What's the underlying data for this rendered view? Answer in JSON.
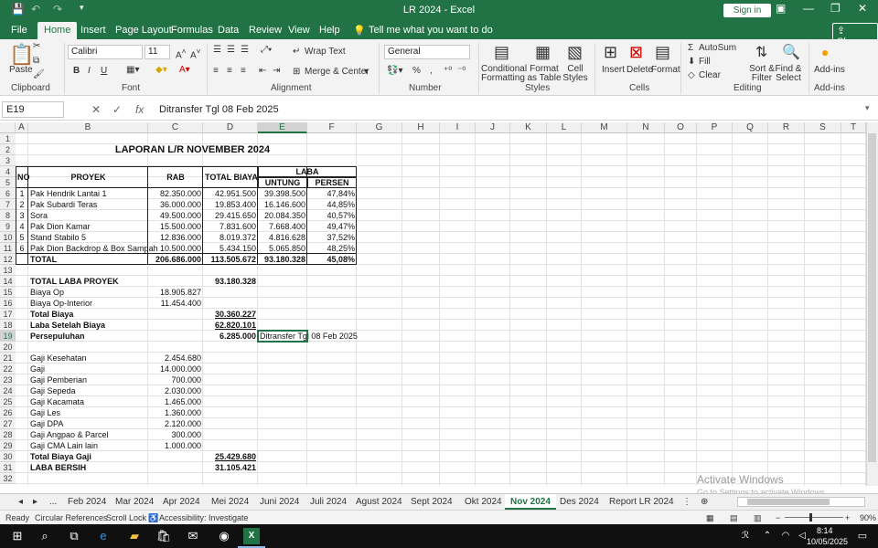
{
  "window": {
    "title": "LR 2024  -  Excel",
    "signin": "Sign in"
  },
  "menu": {
    "tabs": [
      "File",
      "Home",
      "Insert",
      "Page Layout",
      "Formulas",
      "Data",
      "Review",
      "View",
      "Help"
    ],
    "tell": "Tell me what you want to do",
    "share": "Share"
  },
  "ribbon": {
    "clipboard": {
      "paste": "Paste",
      "label": "Clipboard"
    },
    "font": {
      "name": "Calibri",
      "size": "11",
      "label": "Font",
      "bold": "B",
      "italic": "I",
      "underline": "U"
    },
    "alignment": {
      "wrap": "Wrap Text",
      "merge": "Merge & Center",
      "label": "Alignment"
    },
    "number": {
      "format": "General",
      "label": "Number",
      "percent": "%",
      "comma": ","
    },
    "styles": {
      "conditional": "Conditional Formatting",
      "format_table": "Format as Table",
      "cell_styles": "Cell Styles",
      "label": "Styles"
    },
    "cells": {
      "insert": "Insert",
      "delete": "Delete",
      "format": "Format",
      "label": "Cells"
    },
    "editing": {
      "autosum": "AutoSum",
      "fill": "Fill",
      "clear": "Clear",
      "sort": "Sort & Filter",
      "find": "Find & Select",
      "label": "Editing"
    },
    "addins": {
      "addins": "Add-ins",
      "label": "Add-ins"
    }
  },
  "formula": {
    "namebox": "E19",
    "content": "Ditransfer Tgl 08 Feb 2025"
  },
  "columns": [
    "A",
    "B",
    "C",
    "D",
    "E",
    "F",
    "G",
    "H",
    "I",
    "J",
    "K",
    "L",
    "M",
    "N",
    "O",
    "P",
    "Q",
    "R",
    "S",
    "T"
  ],
  "rows": [
    "1",
    "2",
    "3",
    "4",
    "5",
    "6",
    "7",
    "8",
    "9",
    "10",
    "11",
    "12",
    "13",
    "14",
    "15",
    "16",
    "17",
    "18",
    "19",
    "20",
    "21",
    "22",
    "23",
    "24",
    "25",
    "26",
    "27",
    "28",
    "29",
    "30",
    "31",
    "32"
  ],
  "sheet": {
    "title": "LAPORAN L/R NOVEMBER 2024",
    "headers": {
      "no": "NO",
      "proyek": "PROYEK",
      "rab": "RAB",
      "total": "TOTAL BIAYA",
      "laba": "LABA",
      "untung": "UNTUNG",
      "persen": "PERSEN"
    },
    "projects": [
      {
        "no": "1",
        "name": "Pak Hendrik Lantai 1",
        "rab": "82.350.000",
        "total": "42.951.500",
        "untung": "39.398.500",
        "persen": "47,84%"
      },
      {
        "no": "2",
        "name": "Pak Subardi Teras",
        "rab": "36.000.000",
        "total": "19.853.400",
        "untung": "16.146.600",
        "persen": "44,85%"
      },
      {
        "no": "3",
        "name": "Sora",
        "rab": "49.500.000",
        "total": "29.415.650",
        "untung": "20.084.350",
        "persen": "40,57%"
      },
      {
        "no": "4",
        "name": "Pak Dion Kamar",
        "rab": "15.500.000",
        "total": "7.831.600",
        "untung": "7.668.400",
        "persen": "49,47%"
      },
      {
        "no": "5",
        "name": "Stand Stabilo 5",
        "rab": "12.836.000",
        "total": "8.019.372",
        "untung": "4.816.628",
        "persen": "37,52%"
      },
      {
        "no": "6",
        "name": "Pak Dion Backdrop & Box Sampah",
        "rab": "10.500.000",
        "total": "5.434.150",
        "untung": "5.065.850",
        "persen": "48,25%"
      }
    ],
    "total_row": {
      "label": "TOTAL",
      "rab": "206.686.000",
      "total": "113.505.672",
      "untung": "93.180.328",
      "persen": "45,08%"
    },
    "summary": [
      {
        "label": "TOTAL LABA PROYEK",
        "c": "",
        "d": "93.180.328",
        "bold": true
      },
      {
        "label": "Biaya Op",
        "c": "18.905.827",
        "d": "",
        "bold": false
      },
      {
        "label": "Biaya Op-Interior",
        "c": "11.454.400",
        "d": "",
        "bold": false
      },
      {
        "label": "Total Biaya",
        "c": "",
        "d": "30.360.227",
        "bold": true
      },
      {
        "label": "Laba Setelah Biaya",
        "c": "",
        "d": "62.820.101",
        "bold": true
      },
      {
        "label": "Persepuluhan",
        "c": "",
        "d": "6.285.000",
        "bold": true
      }
    ],
    "note": "Ditransfer Tgl 08 Feb 2025",
    "gaji": [
      {
        "label": "Gaji Kesehatan",
        "c": "2.454.680"
      },
      {
        "label": "Gaji",
        "c": "14.000.000"
      },
      {
        "label": "Gaji Pemberian",
        "c": "700.000"
      },
      {
        "label": "Gaji Sepeda",
        "c": "2.030.000"
      },
      {
        "label": "Gaji Kacamata",
        "c": "1.465.000"
      },
      {
        "label": "Gaji Les",
        "c": "1.360.000"
      },
      {
        "label": "Gaji DPA",
        "c": "2.120.000"
      },
      {
        "label": "Gaji Angpao & Parcel",
        "c": "300.000"
      },
      {
        "label": "Gaji CMA Lain lain",
        "c": "1.000.000"
      }
    ],
    "total_gaji": {
      "label": "Total Biaya Gaji",
      "d": "25.429.680"
    },
    "laba_bersih": {
      "label": "LABA BERSIH",
      "d": "31.105.421"
    }
  },
  "sheet_tabs": [
    "Feb 2024",
    "Mar 2024",
    "Apr 2024",
    "Mei 2024",
    "Juni 2024",
    "Juli 2024",
    "Agust 2024",
    "Sept 2024",
    "Okt 2024",
    "Nov 2024",
    "Des 2024",
    "Report LR 2024"
  ],
  "sheet_tabs_more": "...",
  "status": {
    "ready": "Ready",
    "circular": "Circular References",
    "scroll": "Scroll Lock",
    "accessibility": "Accessibility: Investigate",
    "zoom": "90%"
  },
  "watermark": {
    "line1": "Activate Windows",
    "line2": "Go to Settings to activate Windows."
  },
  "taskbar": {
    "time": "8:14",
    "date": "10/05/2025"
  }
}
